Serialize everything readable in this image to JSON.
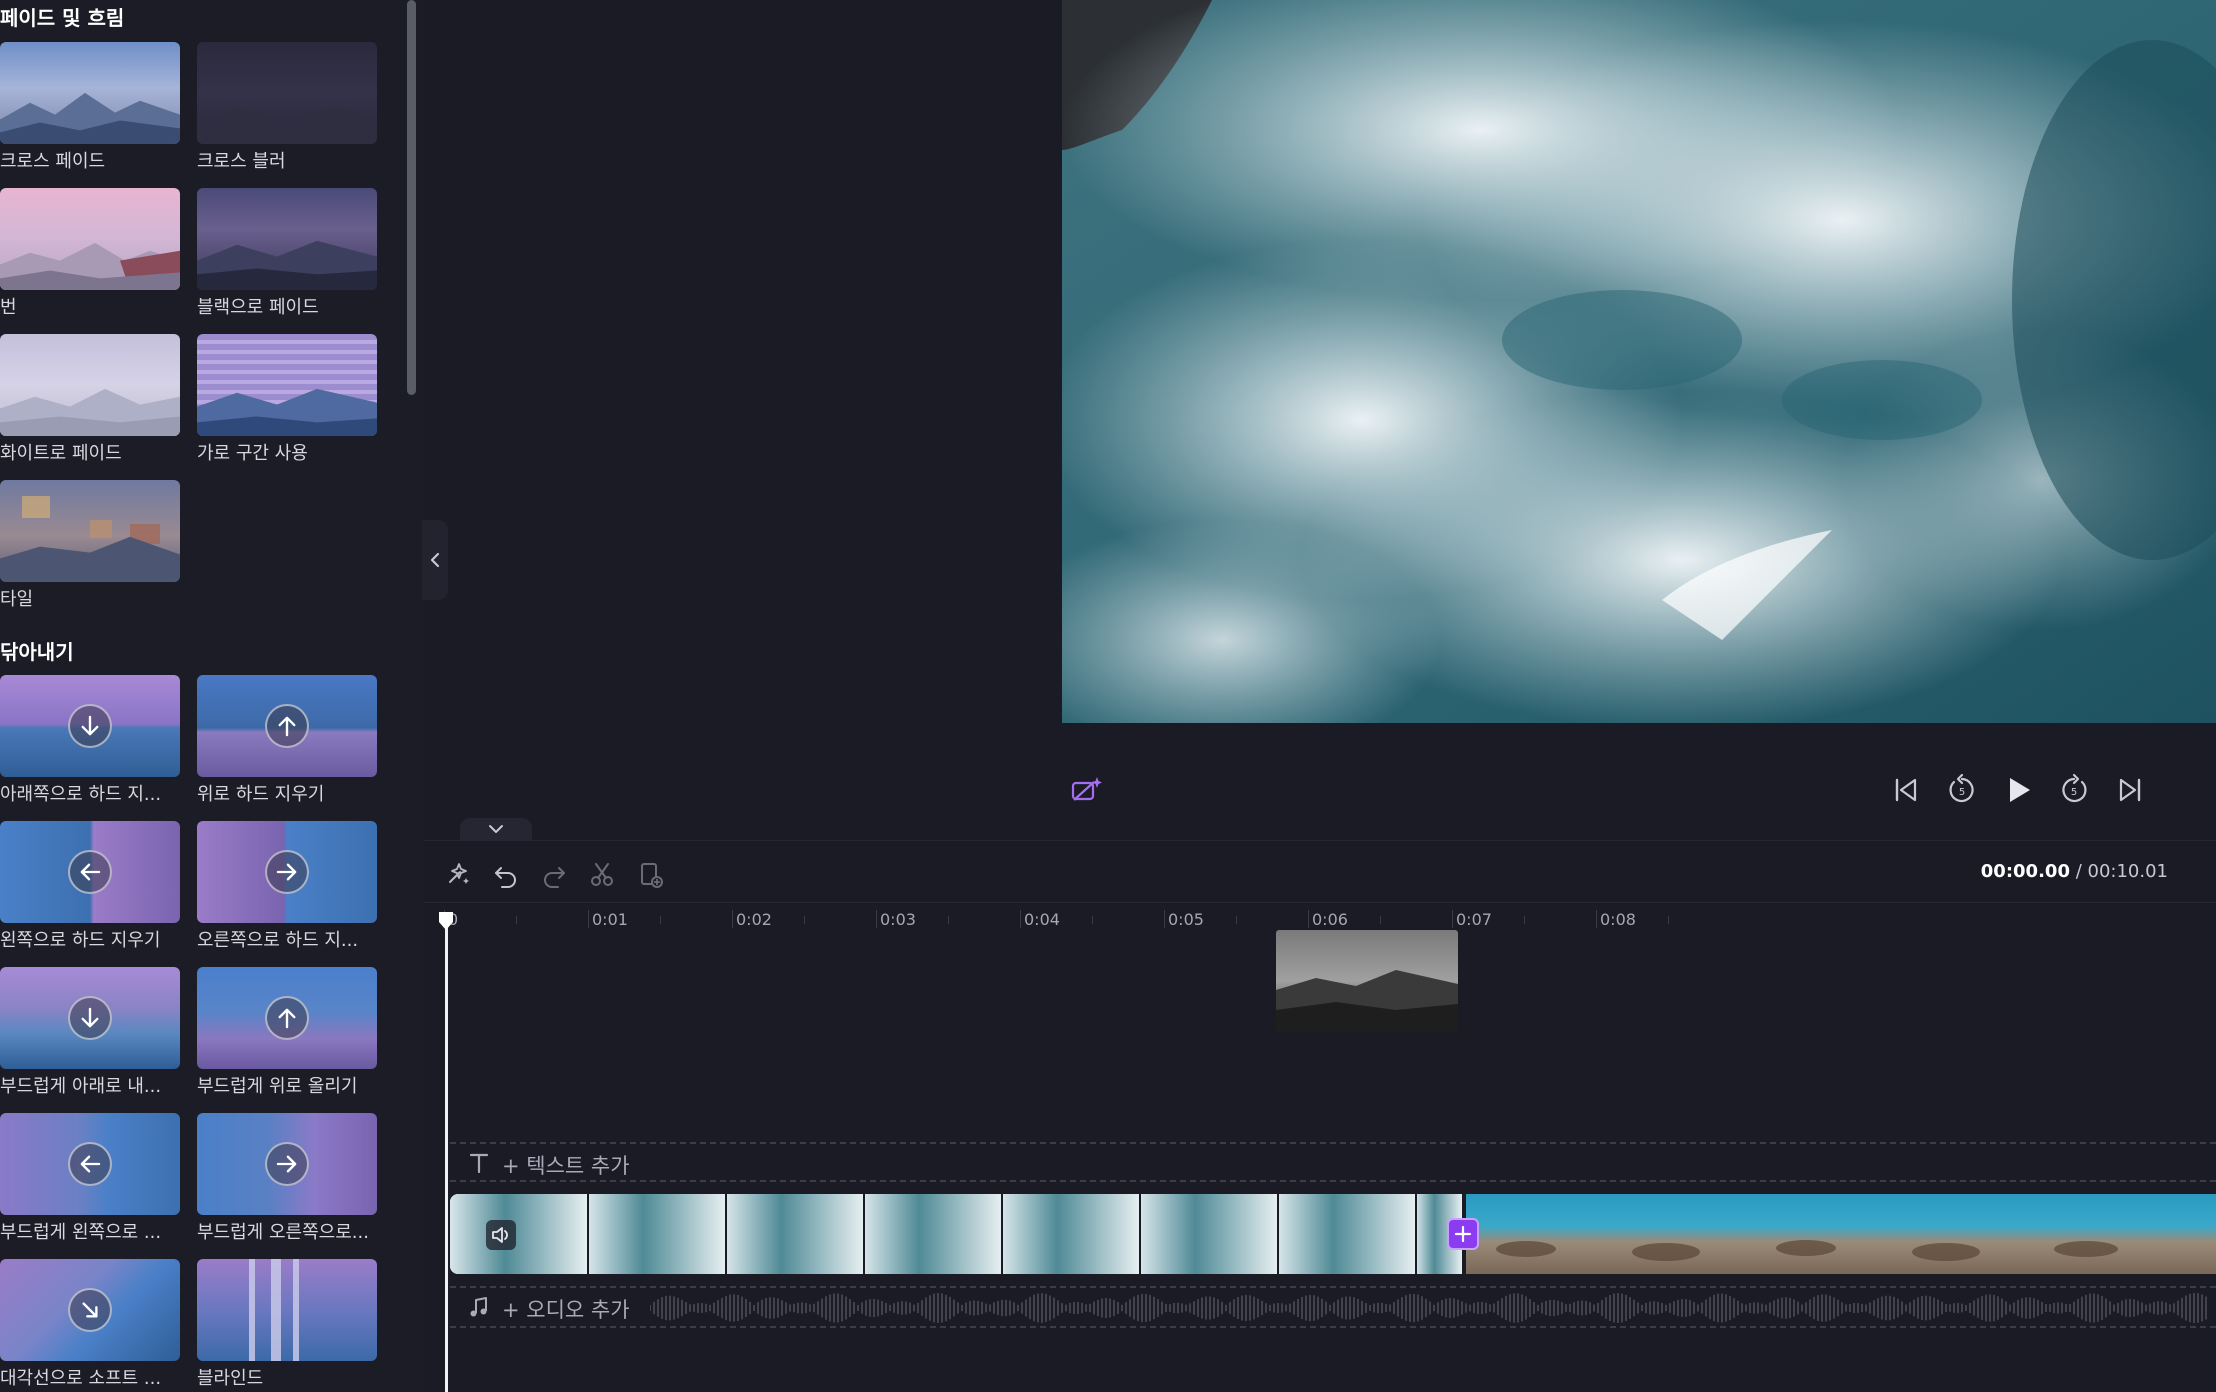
{
  "sections": [
    {
      "title": "페이드 및 흐림",
      "items": [
        {
          "label": "크로스 페이드"
        },
        {
          "label": "크로스 블러"
        },
        {
          "label": "번"
        },
        {
          "label": "블랙으로 페이드"
        },
        {
          "label": "화이트로 페이드"
        },
        {
          "label": "가로 구간 사용"
        },
        {
          "label": "타일"
        }
      ]
    },
    {
      "title": "닦아내기",
      "items": [
        {
          "label": "아래쪽으로 하드 지..."
        },
        {
          "label": "위로 하드 지우기"
        },
        {
          "label": "왼쪽으로 하드 지우기"
        },
        {
          "label": "오른쪽으로 하드 지..."
        },
        {
          "label": "부드럽게 아래로 내..."
        },
        {
          "label": "부드럽게 위로 올리기"
        },
        {
          "label": "부드럽게 왼쪽으로 ..."
        },
        {
          "label": "부드럽게 오른쪽으로..."
        },
        {
          "label": "대각선으로 소프트 ..."
        },
        {
          "label": "블라인드"
        }
      ]
    }
  ],
  "preview": {
    "controls": [
      "skip-back-icon",
      "rewind-5-icon",
      "play-icon",
      "forward-5-icon",
      "skip-forward-icon"
    ]
  },
  "timeline": {
    "current_time": "00:00.00",
    "total_time": "/ 00:10.01",
    "ruler": [
      "0",
      "0:01",
      "0:02",
      "0:03",
      "0:04",
      "0:05",
      "0:06",
      "0:07",
      "0:08"
    ],
    "text_track": {
      "label": "+ 텍스트 추가"
    },
    "audio_track": {
      "label": "+ 오디오 추가"
    }
  },
  "colors": {
    "background": "#1a1b25",
    "accent": "#8c3cf0"
  }
}
